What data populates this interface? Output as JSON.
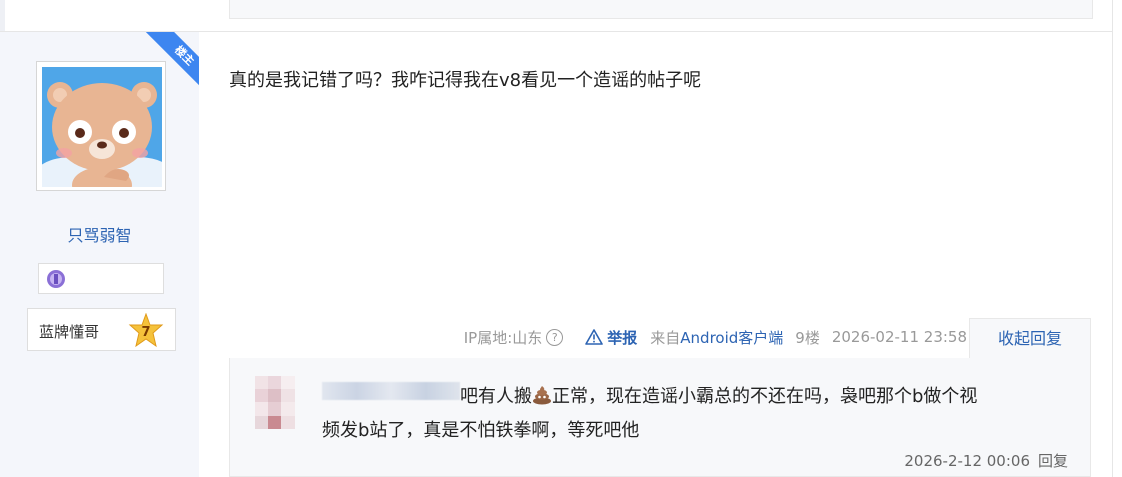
{
  "post": {
    "author_badge": "楼主",
    "author_name": "只骂弱智",
    "level_name": "蓝牌懂哥",
    "level_number": "7",
    "content": "真的是我记错了吗？我咋记得我在v8看见一个造谣的帖子呢",
    "tail": {
      "ip_label": "IP属地:山东",
      "report_label": "举报",
      "from_prefix": "来自",
      "from_client": "Android客户端",
      "floor": "9楼",
      "time": "2026-02-11 23:58"
    },
    "fold_replies_label": "收起回复"
  },
  "reply": {
    "text_line1": "吧有人搬",
    "text_line1_rest": "正常，现在造谣小霸总的不还在吗，袅吧那个b做个视",
    "text_line2": "频发b站了，真是不怕铁拳啊，等死吧他",
    "time": "2026-2-12 00:06",
    "reply_label": "回复"
  },
  "colors": {
    "link_blue": "#2d64b3",
    "sidebar_bg": "#f4f6fb",
    "badge_blue": "#3d86f0"
  },
  "icons": [
    "question-circle-icon",
    "warning-triangle-icon",
    "poop-emoji-icon",
    "level-star-icon",
    "medal-icon"
  ]
}
